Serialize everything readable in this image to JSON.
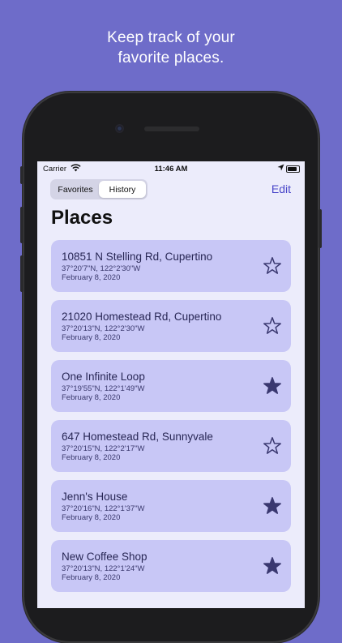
{
  "promo": {
    "line1": "Keep track of your",
    "line2": "favorite places."
  },
  "status_bar": {
    "carrier": "Carrier",
    "time": "11:46 AM"
  },
  "segmented": {
    "favorites_label": "Favorites",
    "history_label": "History",
    "selected": "History"
  },
  "nav": {
    "edit_label": "Edit",
    "title": "Places"
  },
  "colors": {
    "background": "#6e6cc9",
    "card": "#c8c7f6",
    "accent": "#4a47c9",
    "star": "#3a3870"
  },
  "places": [
    {
      "title": "10851 N Stelling Rd, Cupertino",
      "coords": "37°20'7\"N, 122°2'30\"W",
      "date": "February 8, 2020",
      "favorite": false
    },
    {
      "title": "21020 Homestead Rd, Cupertino",
      "coords": "37°20'13\"N, 122°2'30\"W",
      "date": "February 8, 2020",
      "favorite": false
    },
    {
      "title": "One Infinite Loop",
      "coords": "37°19'55\"N, 122°1'49\"W",
      "date": "February 8, 2020",
      "favorite": true
    },
    {
      "title": "647 Homestead Rd, Sunnyvale",
      "coords": "37°20'15\"N, 122°2'17\"W",
      "date": "February 8, 2020",
      "favorite": false
    },
    {
      "title": "Jenn's House",
      "coords": "37°20'16\"N, 122°1'37\"W",
      "date": "February 8, 2020",
      "favorite": true
    },
    {
      "title": "New Coffee Shop",
      "coords": "37°20'13\"N, 122°1'24\"W",
      "date": "February 8, 2020",
      "favorite": true
    }
  ]
}
